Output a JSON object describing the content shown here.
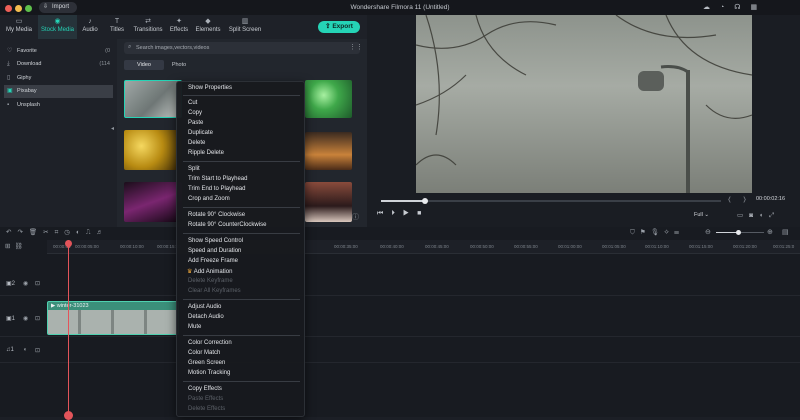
{
  "window": {
    "title": "Wondershare Filmora 11 (Untitled)"
  },
  "toolbar": {
    "import_label": "Import",
    "export_label": "Export"
  },
  "nav_tabs": [
    {
      "label": "My Media",
      "icon": "folder-icon"
    },
    {
      "label": "Stock Media",
      "icon": "stock-media-icon",
      "active": true
    },
    {
      "label": "Audio",
      "icon": "music-note-icon"
    },
    {
      "label": "Titles",
      "icon": "titles-icon"
    },
    {
      "label": "Transitions",
      "icon": "transitions-icon"
    },
    {
      "label": "Effects",
      "icon": "effects-icon"
    },
    {
      "label": "Elements",
      "icon": "elements-icon"
    },
    {
      "label": "Split Screen",
      "icon": "split-screen-icon"
    }
  ],
  "sidebar": {
    "items": [
      {
        "label": "Favorite",
        "count": "(0",
        "icon": "heart-icon"
      },
      {
        "label": "Download",
        "count": "(114",
        "icon": "download-icon"
      },
      {
        "label": "Giphy",
        "count": "",
        "icon": "giphy-icon"
      },
      {
        "label": "Pixabay",
        "count": "",
        "icon": "pixabay-icon",
        "selected": true
      },
      {
        "label": "Unsplash",
        "count": "",
        "icon": "unsplash-icon"
      }
    ]
  },
  "search": {
    "placeholder": "Search images,vectors,videos"
  },
  "media_tabs": [
    {
      "label": "Video",
      "active": true
    },
    {
      "label": "Photo",
      "active": false
    }
  ],
  "context_menu": {
    "groups": [
      [
        {
          "label": "Show Properties",
          "enabled": true
        }
      ],
      [
        {
          "label": "Cut",
          "enabled": true
        },
        {
          "label": "Copy",
          "enabled": true
        },
        {
          "label": "Paste",
          "enabled": true
        },
        {
          "label": "Duplicate",
          "enabled": true
        },
        {
          "label": "Delete",
          "enabled": true
        },
        {
          "label": "Ripple Delete",
          "enabled": true
        }
      ],
      [
        {
          "label": "Split",
          "enabled": true
        },
        {
          "label": "Trim Start to Playhead",
          "enabled": true
        },
        {
          "label": "Trim End to Playhead",
          "enabled": true
        },
        {
          "label": "Crop and Zoom",
          "enabled": true
        }
      ],
      [
        {
          "label": "Rotate 90° Clockwise",
          "enabled": true
        },
        {
          "label": "Rotate 90° CounterClockwise",
          "enabled": true
        }
      ],
      [
        {
          "label": "Show Speed Control",
          "enabled": true
        },
        {
          "label": "Speed and Duration",
          "enabled": true
        },
        {
          "label": "Add Freeze Frame",
          "enabled": true
        },
        {
          "label": "Add Animation",
          "enabled": true,
          "icon": "crown-icon"
        },
        {
          "label": "Delete Keyframe",
          "enabled": false
        },
        {
          "label": "Clear All Keyframes",
          "enabled": false
        }
      ],
      [
        {
          "label": "Adjust Audio",
          "enabled": true
        },
        {
          "label": "Detach Audio",
          "enabled": true
        },
        {
          "label": "Mute",
          "enabled": true
        }
      ],
      [
        {
          "label": "Color Correction",
          "enabled": true
        },
        {
          "label": "Color Match",
          "enabled": true
        },
        {
          "label": "Green Screen",
          "enabled": true
        },
        {
          "label": "Motion Tracking",
          "enabled": true
        }
      ],
      [
        {
          "label": "Copy Effects",
          "enabled": true
        },
        {
          "label": "Paste Effects",
          "enabled": false
        },
        {
          "label": "Delete Effects",
          "enabled": false
        }
      ]
    ]
  },
  "player": {
    "time": "00:00:02:16",
    "quality": "Full",
    "progress": 0.13
  },
  "timeline": {
    "ticks": [
      "00:00:00",
      "00:00:05:00",
      "00:00:10:00",
      "00:00:15:00",
      "00:00:35:00",
      "00:00:40:00",
      "00:00:45:00",
      "00:00:50:00",
      "00:00:55:00",
      "00:01:00:00",
      "00:01:05:00",
      "00:01:10:00",
      "00:01:15:00",
      "00:01:20:00",
      "00:01:25:0"
    ],
    "tracks": [
      {
        "label": "2"
      },
      {
        "label": "1"
      },
      {
        "label": "1"
      }
    ],
    "clip_label": "winter-31023",
    "zoom": 0.45
  },
  "colors": {
    "accent": "#25d4b6",
    "playhead": "#e2545a"
  }
}
